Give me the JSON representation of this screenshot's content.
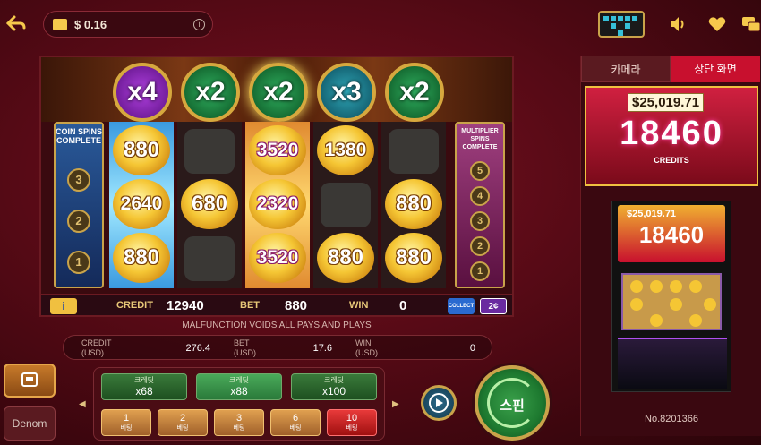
{
  "topbar": {
    "balance": "$ 0.16",
    "info_glyph": "i",
    "icons": [
      "back-arrow-icon",
      "wallet-icon",
      "info-icon",
      "grid-menu-icon",
      "sound-icon",
      "heart-icon",
      "language-icon"
    ]
  },
  "game": {
    "multipliers": [
      "x4",
      "x2",
      "x2",
      "x3",
      "x2"
    ],
    "coin_panel": {
      "title": "COIN SPINS COMPLETE",
      "values": [
        "3",
        "2",
        "1"
      ]
    },
    "multiplier_panel": {
      "title": "MULTIPLIER SPINS COMPLETE",
      "values": [
        "5",
        "4",
        "3",
        "2",
        "1"
      ]
    },
    "reels": [
      [
        "880",
        "2640",
        "880"
      ],
      [
        "",
        "680",
        ""
      ],
      [
        "3520",
        "2320",
        "3520"
      ],
      [
        "1380",
        "",
        "880"
      ],
      [
        "",
        "880",
        "880"
      ]
    ],
    "bar": {
      "info_glyph": "i",
      "credit_label": "CREDIT",
      "credit_value": "12940",
      "bet_label": "BET",
      "bet_value": "880",
      "win_label": "WIN",
      "win_value": "0",
      "collect_label": "COLLECT",
      "denom_label": "2¢"
    }
  },
  "notice": "MALFUNCTION VOIDS ALL PAYS AND PLAYS",
  "info_row": {
    "credit_label": "CREDIT",
    "credit_sub": "(USD)",
    "credit_value": "276.4",
    "bet_label": "BET",
    "bet_sub": "(USD)",
    "bet_value": "17.6",
    "win_label": "WIN",
    "win_sub": "(USD)",
    "win_value": "0"
  },
  "controls": {
    "denom_label": "Denom",
    "credit_options": [
      {
        "top": "크레딧",
        "value": "x68"
      },
      {
        "top": "크레딧",
        "value": "x88",
        "active": true
      },
      {
        "top": "크레딧",
        "value": "x100"
      }
    ],
    "line_options": [
      {
        "value": "1",
        "sub": "베팅"
      },
      {
        "value": "2",
        "sub": "베팅"
      },
      {
        "value": "3",
        "sub": "베팅"
      },
      {
        "value": "6",
        "sub": "베팅"
      },
      {
        "value": "10",
        "sub": "베팅",
        "active": true
      }
    ],
    "spin_label": "스핀"
  },
  "right_panel": {
    "tabs": [
      "카메라",
      "상단 화면"
    ],
    "active_tab": "상단 화면",
    "jackpot_amount": "$25,019.71",
    "jackpot_credits": "18460",
    "jackpot_credits_label": "CREDITS",
    "cabinet_amount": "$25,019.71",
    "cabinet_credits": "18460",
    "machine_no": "No.8201366"
  },
  "colors": {
    "background": "#4a0812",
    "accent_gold": "#c9a34a",
    "spin_green": "#1e7a30",
    "tab_active": "#c8102e"
  }
}
